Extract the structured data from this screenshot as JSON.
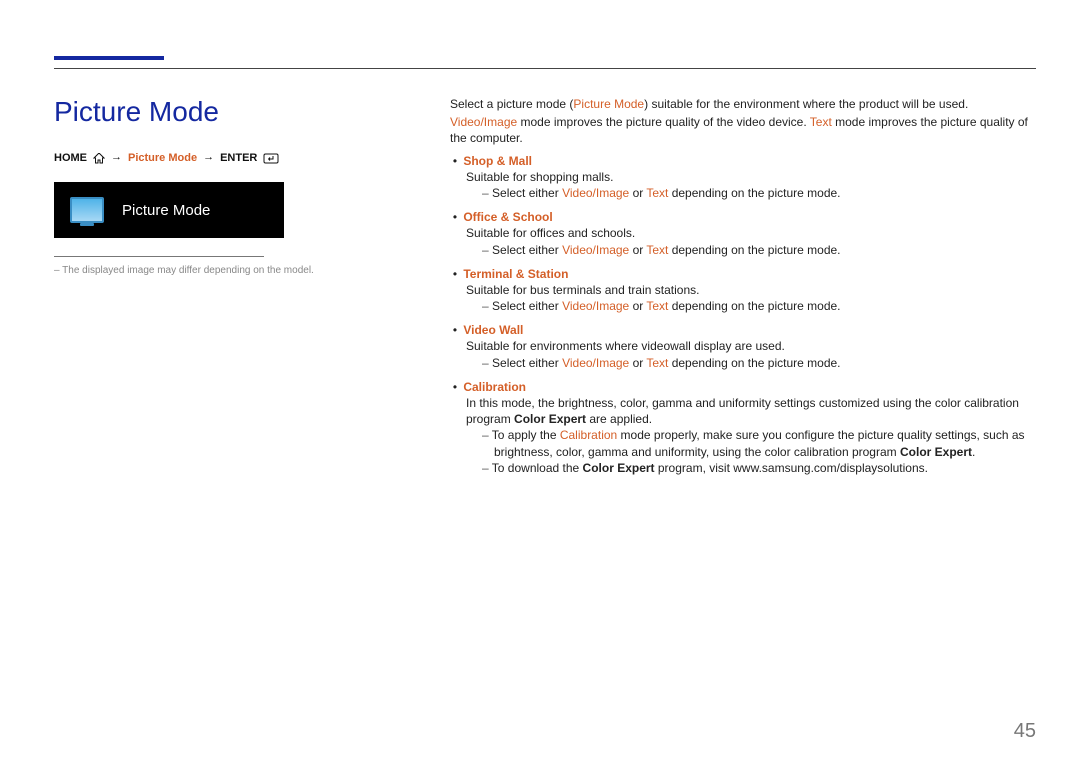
{
  "title": "Picture Mode",
  "breadcrumb": {
    "home": "HOME",
    "mode": "Picture Mode",
    "enter": "ENTER"
  },
  "screenshot_label": "Picture Mode",
  "footnote": "The displayed image may differ depending on the model.",
  "page_num": "45",
  "intro1_a": "Select a picture mode (",
  "intro1_b": "Picture Mode",
  "intro1_c": ") suitable for the environment where the product will be used.",
  "intro2_a": "Video/Image",
  "intro2_b": " mode improves the picture quality of the video device. ",
  "intro2_c": "Text",
  "intro2_d": " mode improves the picture quality of the computer.",
  "modes": {
    "shop": {
      "title": "Shop & Mall",
      "desc": "Suitable for shopping malls.",
      "sub_a": "Select either ",
      "sub_b": "Video/Image",
      "sub_c": " or ",
      "sub_d": "Text",
      "sub_e": " depending on the picture mode."
    },
    "office": {
      "title": "Office & School",
      "desc": "Suitable for offices and schools.",
      "sub_a": "Select either ",
      "sub_b": "Video/Image",
      "sub_c": " or ",
      "sub_d": "Text",
      "sub_e": " depending on the picture mode."
    },
    "terminal": {
      "title": "Terminal & Station",
      "desc": "Suitable for bus terminals and train stations.",
      "sub_a": "Select either ",
      "sub_b": "Video/Image",
      "sub_c": " or ",
      "sub_d": "Text",
      "sub_e": " depending on the picture mode."
    },
    "videowall": {
      "title": "Video Wall",
      "desc": "Suitable for environments where videowall display are used.",
      "sub_a": "Select either ",
      "sub_b": "Video/Image",
      "sub_c": " or ",
      "sub_d": "Text",
      "sub_e": " depending on the picture mode."
    },
    "calibration": {
      "title": "Calibration",
      "desc_a": "In this mode, the brightness, color, gamma and uniformity settings customized using the color calibration program ",
      "desc_b": "Color Expert",
      "desc_c": " are applied.",
      "sub1_a": "To apply the ",
      "sub1_b": "Calibration",
      "sub1_c": " mode properly, make sure you configure the picture quality settings, such as brightness, color, gamma and uniformity, using the color calibration program ",
      "sub1_d": "Color Expert",
      "sub1_e": ".",
      "sub2_a": "To download the ",
      "sub2_b": "Color Expert",
      "sub2_c": " program, visit www.samsung.com/displaysolutions."
    }
  }
}
